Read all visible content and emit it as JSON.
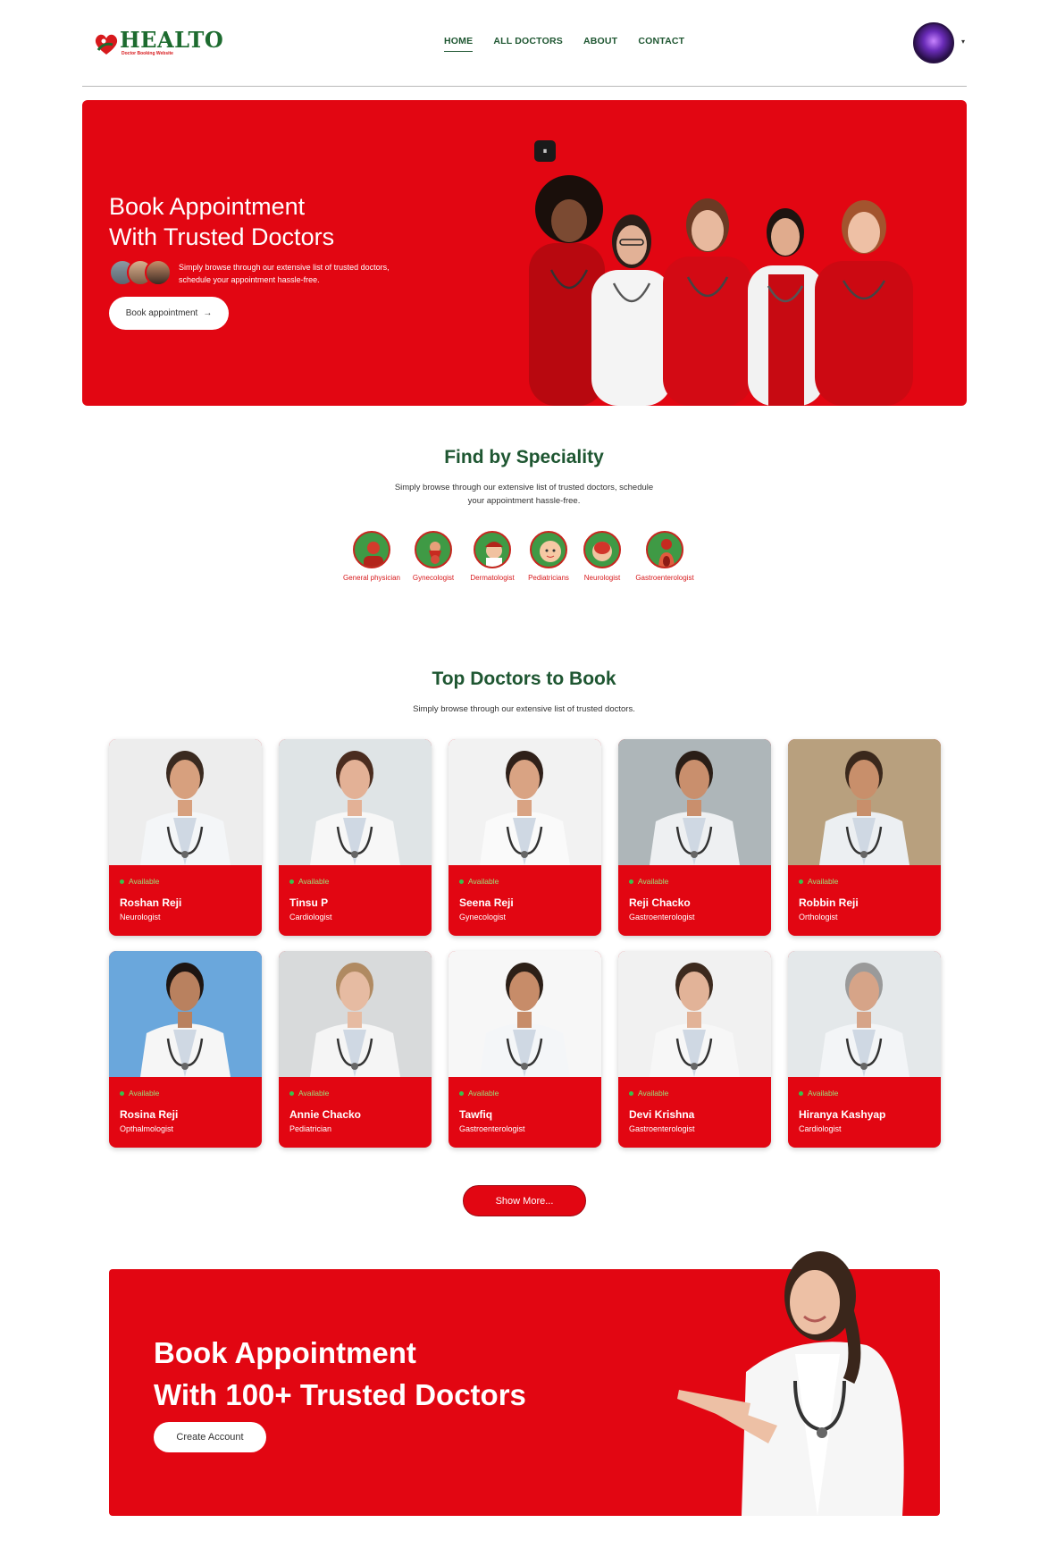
{
  "brand": {
    "name": "HEALTO",
    "tagline": "Doctor Booking Website"
  },
  "nav": {
    "items": [
      "HOME",
      "ALL DOCTORS",
      "ABOUT",
      "CONTACT"
    ],
    "active": "HOME",
    "caret": "▾"
  },
  "hero": {
    "title_line1": "Book Appointment",
    "title_line2": "With Trusted Doctors",
    "description": "Simply browse through our extensive list of trusted doctors, schedule your appointment hassle-free.",
    "button": "Book appointment",
    "button_arrow": "→",
    "badge": "⏸"
  },
  "speciality": {
    "title": "Find by Speciality",
    "description_line1": "Simply browse through our extensive list of trusted doctors, schedule",
    "description_line2": "your appointment hassle-free.",
    "items": [
      {
        "label": "General physician",
        "icon": "general-physician-icon"
      },
      {
        "label": "Gynecologist",
        "icon": "gynecologist-icon"
      },
      {
        "label": "Dermatologist",
        "icon": "dermatologist-icon"
      },
      {
        "label": "Pediatricians",
        "icon": "pediatrician-icon"
      },
      {
        "label": "Neurologist",
        "icon": "neurologist-icon"
      },
      {
        "label": "Gastroenterologist",
        "icon": "gastroenterologist-icon"
      }
    ]
  },
  "doctors": {
    "title": "Top Doctors to Book",
    "description": "Simply browse through our extensive list of trusted doctors.",
    "available_label": "Available",
    "list": [
      {
        "name": "Roshan Reji",
        "speciality": "Neurologist",
        "bg": "#ededed",
        "coat": "#f4f6f8",
        "skin": "#d7a07e",
        "hair": "#3a2a20"
      },
      {
        "name": "Tinsu P",
        "speciality": "Cardiologist",
        "bg": "#dfe4e6",
        "coat": "#f7f7f7",
        "skin": "#e3b196",
        "hair": "#4a2c1f"
      },
      {
        "name": "Seena Reji",
        "speciality": "Gynecologist",
        "bg": "#f2f2f2",
        "coat": "#fafafa",
        "skin": "#d9a383",
        "hair": "#2f2019"
      },
      {
        "name": "Reji Chacko",
        "speciality": "Gastroenterologist",
        "bg": "#aeb6b9",
        "coat": "#eef0f2",
        "skin": "#c98f6d",
        "hair": "#2a1e17"
      },
      {
        "name": "Robbin Reji",
        "speciality": "Orthologist",
        "bg": "#b8a07e",
        "coat": "#eceff2",
        "skin": "#c88f6b",
        "hair": "#3a281c"
      },
      {
        "name": "Rosina Reji",
        "speciality": "Opthalmologist",
        "bg": "#6aa7dc",
        "coat": "#f6f6f6",
        "skin": "#b9815f",
        "hair": "#1d1512"
      },
      {
        "name": "Annie Chacko",
        "speciality": "Pediatrician",
        "bg": "#d8dadb",
        "coat": "#f5f5f5",
        "skin": "#e6bba2",
        "hair": "#b08a62"
      },
      {
        "name": "Tawfiq",
        "speciality": "Gastroenterologist",
        "bg": "#f7f7f7",
        "coat": "#f4f6f8",
        "skin": "#c78c69",
        "hair": "#2c1f17"
      },
      {
        "name": "Devi Krishna",
        "speciality": "Gastroenterologist",
        "bg": "#f1f1f1",
        "coat": "#f7f7f7",
        "skin": "#e2b398",
        "hair": "#3d2a1e"
      },
      {
        "name": "Hiranya Kashyap",
        "speciality": "Cardiologist",
        "bg": "#e4e8ea",
        "coat": "#f3f5f7",
        "skin": "#d6a488",
        "hair": "#9a9a9a"
      }
    ],
    "more_button": "Show More..."
  },
  "banner": {
    "title_line1": "Book Appointment",
    "title_line2": "With 100+ Trusted Doctors",
    "button": "Create Account"
  },
  "colors": {
    "primary_red": "#e20612",
    "brand_green": "#1e5631"
  }
}
